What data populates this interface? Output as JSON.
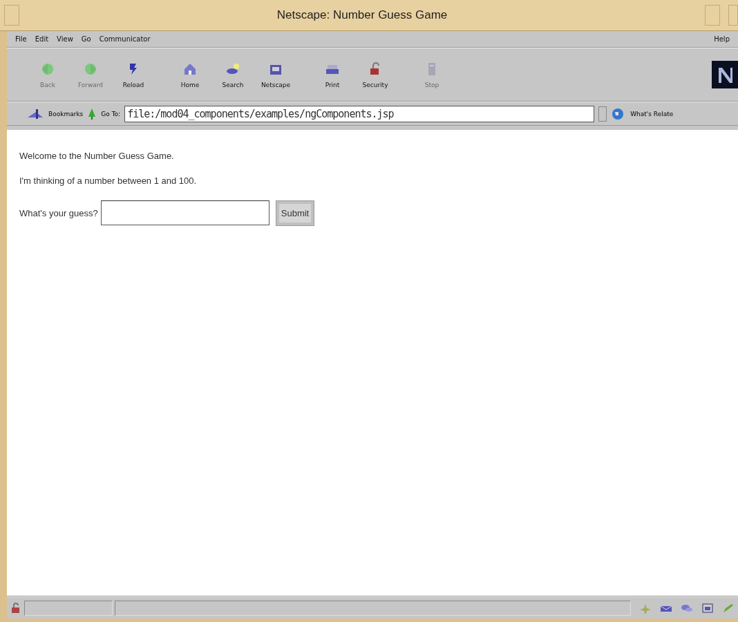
{
  "window": {
    "title": "Netscape: Number Guess Game"
  },
  "menu": {
    "items": [
      "File",
      "Edit",
      "View",
      "Go",
      "Communicator"
    ],
    "help": "Help"
  },
  "toolbar": {
    "buttons": [
      {
        "label": "Back",
        "disabled": true
      },
      {
        "label": "Forward",
        "disabled": true
      },
      {
        "label": "Reload",
        "disabled": false
      },
      {
        "label": "Home",
        "disabled": false
      },
      {
        "label": "Search",
        "disabled": false
      },
      {
        "label": "Netscape",
        "disabled": false
      },
      {
        "label": "Print",
        "disabled": false
      },
      {
        "label": "Security",
        "disabled": false
      },
      {
        "label": "Stop",
        "disabled": true
      }
    ]
  },
  "location": {
    "bookmarks": "Bookmarks",
    "go_to": "Go To:",
    "url": "file:/mod04_components/examples/ngComponents.jsp",
    "related": "What's Relate"
  },
  "page": {
    "lines": [
      "Welcome to the Number Guess Game.",
      "I'm thinking of a number between 1 and 100."
    ],
    "prompt": "What's your guess?",
    "submit": "Submit"
  }
}
